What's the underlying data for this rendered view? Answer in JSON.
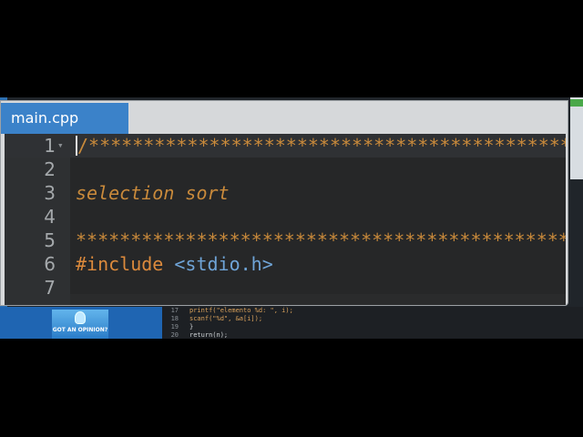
{
  "editor": {
    "tab": "main.cpp",
    "lines": [
      {
        "num": "1",
        "text": "/*********************************************"
      },
      {
        "num": "2",
        "text": ""
      },
      {
        "num": "3",
        "text": "selection sort"
      },
      {
        "num": "4",
        "text": ""
      },
      {
        "num": "5",
        "text": "*********************************************"
      },
      {
        "num": "6",
        "keyword": "#include",
        "include": "<stdio.h>"
      },
      {
        "num": "7",
        "text": ""
      }
    ]
  },
  "background": {
    "ad_text": "GOT AN OPINION?",
    "code_lines": [
      {
        "num": "17",
        "text": "    printf(\"elemento %d: \", i);"
      },
      {
        "num": "18",
        "text": "    scanf(\"%d\", &a[i]);"
      },
      {
        "num": "19",
        "text": "  }"
      },
      {
        "num": "20",
        "text": "  return(n);"
      }
    ]
  },
  "colors": {
    "tab_active": "#3b82c9",
    "editor_bg": "#262728",
    "comment": "#c98a3b",
    "include_path": "#6fa4d7"
  }
}
